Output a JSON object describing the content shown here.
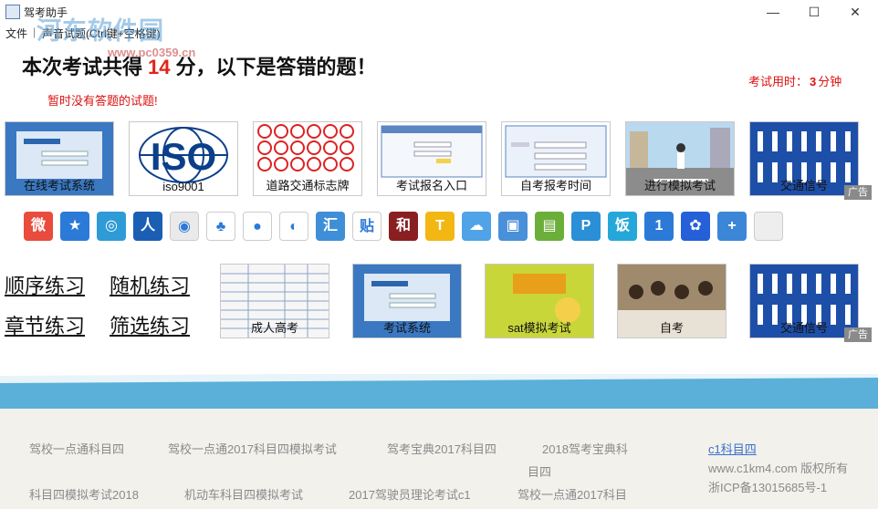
{
  "window": {
    "title": "驾考助手",
    "minimize": "—",
    "maximize": "☐",
    "close": "✕"
  },
  "menu": {
    "file": "文件",
    "sep": "|",
    "voice": "声音试题(Ctrl键+空格键)"
  },
  "watermark": {
    "text": "河东软件园",
    "url": "www.pc0359.cn"
  },
  "result": {
    "prefix": "本次考试共得",
    "score": "14",
    "suffix": "分，以下是答错的题！",
    "time_prefix": "考试用时：",
    "time_value": "3",
    "time_unit": "分钟",
    "no_wrong": "暂时没有答题的试题!"
  },
  "ads_row1": [
    {
      "caption": "在线考试系统",
      "icon": "login-screenshot"
    },
    {
      "caption": "iso9001",
      "icon": "iso-logo"
    },
    {
      "caption": "道路交通标志牌",
      "icon": "traffic-signs"
    },
    {
      "caption": "考试报名入口",
      "icon": "register-form"
    },
    {
      "caption": "自考报考时间",
      "icon": "exam-login-form"
    },
    {
      "caption": "进行模拟考试",
      "icon": "road-scene"
    },
    {
      "caption": "交通信号",
      "icon": "traffic-police-gestures"
    }
  ],
  "ads_row2": [
    {
      "caption": "成人高考",
      "icon": "score-table"
    },
    {
      "caption": "考试系统",
      "icon": "login-screenshot"
    },
    {
      "caption": "sat模拟考试",
      "icon": "sat-book"
    },
    {
      "caption": "自考",
      "icon": "classroom-photo"
    },
    {
      "caption": "交通信号",
      "icon": "traffic-police-gestures"
    }
  ],
  "ad_badge": "广告",
  "app_icons": [
    {
      "name": "weibo-icon",
      "bg": "#e94b3c",
      "glyph": "微"
    },
    {
      "name": "favorite-star-icon",
      "bg": "#2b7ad8",
      "glyph": "★"
    },
    {
      "name": "qzone-icon",
      "bg": "#2e9bd6",
      "glyph": "◎"
    },
    {
      "name": "renren-icon",
      "bg": "#1a5fb4",
      "glyph": "人"
    },
    {
      "name": "tencent-weibo-icon",
      "bg": "#eaeaea",
      "glyph": "◉"
    },
    {
      "name": "clover-icon",
      "bg": "#ffffff",
      "glyph": "♣"
    },
    {
      "name": "qq-icon",
      "bg": "#ffffff",
      "glyph": "●"
    },
    {
      "name": "share-circle-icon",
      "bg": "#ffffff",
      "glyph": "◐"
    },
    {
      "name": "huijie-icon",
      "bg": "#3e8fd8",
      "glyph": "汇"
    },
    {
      "name": "tieba-icon",
      "bg": "#ffffff",
      "glyph": "贴"
    },
    {
      "name": "heyishe-icon",
      "bg": "#8a1f22",
      "glyph": "和"
    },
    {
      "name": "t-icon",
      "bg": "#f2b713",
      "glyph": "T"
    },
    {
      "name": "cloud-icon",
      "bg": "#4fa3e6",
      "glyph": "☁"
    },
    {
      "name": "photo-icon",
      "bg": "#4a90d9",
      "glyph": "▣"
    },
    {
      "name": "notebook-icon",
      "bg": "#6cae3a",
      "glyph": "▤"
    },
    {
      "name": "wifi-share-icon",
      "bg": "#2a8fd6",
      "glyph": "P"
    },
    {
      "name": "fan-icon",
      "bg": "#25a8d9",
      "glyph": "饭"
    },
    {
      "name": "one-icon",
      "bg": "#2b7ad8",
      "glyph": "1"
    },
    {
      "name": "baidu-paw-icon",
      "bg": "#2560d8",
      "glyph": "✿"
    },
    {
      "name": "plus-icon",
      "bg": "#3c86d8",
      "glyph": "+"
    },
    {
      "name": "blank-icon",
      "bg": "#eeeeee",
      "glyph": ""
    }
  ],
  "practice": {
    "sequence": "顺序练习",
    "random": "随机练习",
    "chapter": "章节练习",
    "filter": "筛选练习"
  },
  "footer": {
    "links": [
      "驾校一点通科目四",
      "驾校一点通2017科目四模拟考试",
      "驾考宝典2017科目四",
      "2018驾考宝典科",
      "目四",
      "科目四模拟考试2018",
      "机动车科目四模拟考试",
      "2017驾驶员理论考试c1",
      "驾校一点通2017科目"
    ],
    "c1_link": "c1科目四",
    "copyright": "www.c1km4.com 版权所有",
    "icp": "浙ICP备13015685号-1"
  }
}
